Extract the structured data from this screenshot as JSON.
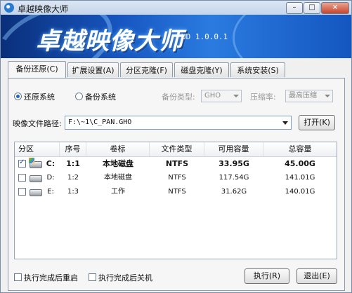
{
  "window": {
    "title": "卓越映像大师",
    "controls": {
      "minimize": "–",
      "maximize": "□",
      "close": "×"
    }
  },
  "banner": {
    "logo_text": "卓越映像大师",
    "version": "UD 1.0.0.1"
  },
  "tabs": [
    {
      "label": "备份还原(C)",
      "active": true
    },
    {
      "label": "扩展设置(A)",
      "active": false
    },
    {
      "label": "分区克隆(F)",
      "active": false
    },
    {
      "label": "磁盘克隆(Y)",
      "active": false
    },
    {
      "label": "系统安装(S)",
      "active": false
    }
  ],
  "mode": {
    "restore_label": "还原系统",
    "backup_label": "备份系统",
    "selected": "restore",
    "backup_type_label": "备份类型:",
    "backup_type_value": "GHO",
    "compression_label": "压缩率:",
    "compression_value": "最高压缩"
  },
  "image_path": {
    "label": "映像文件路径:",
    "value": "F:\\~1\\C_PAN.GHO",
    "open_button": "打开(K)"
  },
  "table": {
    "columns": [
      "分区",
      "序号",
      "卷标",
      "文件类型",
      "可用容量",
      "总容量"
    ],
    "rows": [
      {
        "checked": true,
        "drive": "C:",
        "index": "1:1",
        "label": "本地磁盘",
        "fs": "NTFS",
        "free": "33.95G",
        "total": "45.00G",
        "bold": true,
        "system": true
      },
      {
        "checked": false,
        "drive": "D:",
        "index": "1:2",
        "label": "本地磁盘",
        "fs": "NTFS",
        "free": "117.54G",
        "total": "141.01G",
        "bold": false,
        "system": false
      },
      {
        "checked": false,
        "drive": "E:",
        "index": "1:3",
        "label": "工作",
        "fs": "NTFS",
        "free": "31.62G",
        "total": "140.01G",
        "bold": false,
        "system": false
      }
    ]
  },
  "footer": {
    "reboot_label": "执行完成后重启",
    "shutdown_label": "执行完成后关机",
    "execute_button": "执行(R)",
    "exit_button": "退出(E)"
  },
  "colors": {
    "banner": "#1757c2",
    "accent": "#1f64c8"
  }
}
